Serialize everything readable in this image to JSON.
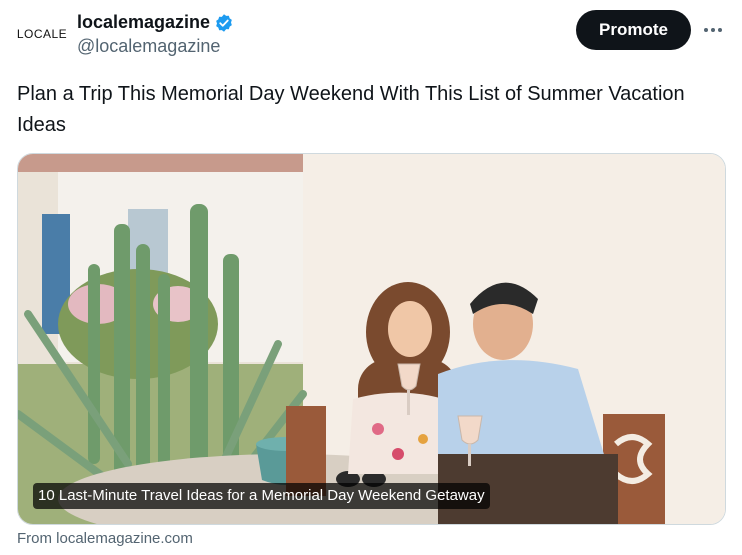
{
  "account": {
    "logo_text": "LOCALE",
    "display_name": "localemagazine",
    "handle": "@localemagazine",
    "verified": true
  },
  "actions": {
    "promote_label": "Promote",
    "more_icon": "more-dots-icon"
  },
  "tweet": {
    "text": "Plan a Trip This Memorial Day Weekend With This List of Summer Vacation Ideas"
  },
  "card": {
    "image_caption": "10 Last-Minute Travel Ideas for a Memorial Day Weekend Getaway",
    "source": "From localemagazine.com"
  },
  "colors": {
    "accent_blue": "#1d9bf0",
    "text_primary": "#0f1419",
    "text_secondary": "#536471",
    "promote_bg": "#0f1419"
  }
}
